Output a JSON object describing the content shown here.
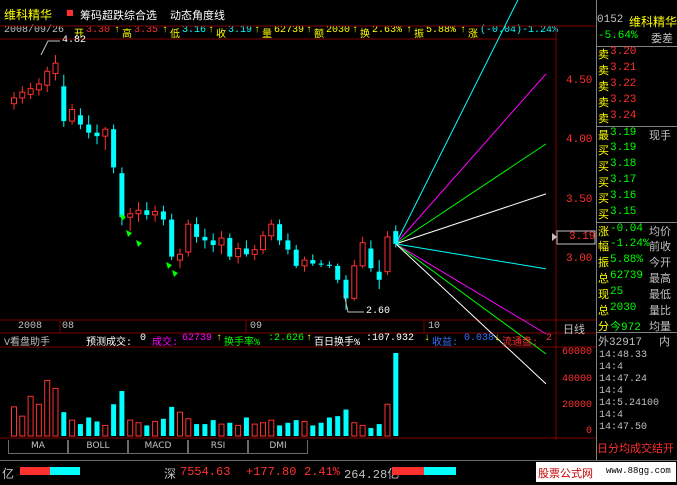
{
  "title": {
    "stock_name": "维科精华",
    "indicator_name": "筹码超跌综合选",
    "overlay_name": "动态角度线",
    "code_tail": "0152",
    "right_name": "维科精华"
  },
  "infobar": {
    "date": "2008/09/26",
    "open_label": "开",
    "open": "3.30",
    "high_label": "高",
    "high": "3.35",
    "low_label": "低",
    "low": "3.16",
    "close_label": "收",
    "close": "3.19",
    "volume_label": "量",
    "volume": "62739",
    "amount_label": "额",
    "amount": "2030",
    "turnover_label": "换",
    "turnover": "2.63%",
    "amplitude_label": "振",
    "amplitude": "5.88%",
    "change_label": "涨",
    "change": "(-0.04)-1.24%"
  },
  "price_axis": {
    "labels": [
      "4.50",
      "4.00",
      "3.50",
      "3.00"
    ],
    "current_tag": "3.19",
    "high_note": "4.82",
    "low_note": "2.60"
  },
  "time_axis": {
    "labels": [
      "2008",
      "08",
      "09",
      "10"
    ],
    "period": "日线"
  },
  "volume_panel": {
    "name": "V看盘助手",
    "forecast_label": "预测成交:",
    "forecast": "0",
    "vol_label": "成交:",
    "vol": "62739",
    "turn_label": "换手率%",
    "turn": ":2.626",
    "bh_label": "百日换手%",
    "bh": ":107.932",
    "close_label": "收益:",
    "close_val": "0.038",
    "lt_label": "流通盘:",
    "lt": "2",
    "axis": [
      "60000",
      "40000",
      "20000",
      "0"
    ]
  },
  "tabs": [
    "MA",
    "BOLL",
    "MACD",
    "RSI",
    "DMI"
  ],
  "right_panel": {
    "top_change": "-5.64%",
    "top_label": "委差",
    "asks": [
      {
        "label": "卖",
        "price": "3.24"
      },
      {
        "label": "卖",
        "price": "3.23"
      },
      {
        "label": "卖",
        "price": "3.22"
      },
      {
        "label": "卖",
        "price": "3.21"
      },
      {
        "label": "卖",
        "price": "3.20"
      }
    ],
    "best_label": "最",
    "best_price": "3.19",
    "best_tail": "现手",
    "bids": [
      {
        "label": "买",
        "price": "3.19"
      },
      {
        "label": "买",
        "price": "3.18"
      },
      {
        "label": "买",
        "price": "3.17"
      },
      {
        "label": "买",
        "price": "3.16"
      },
      {
        "label": "买",
        "price": "3.15"
      }
    ],
    "stats": [
      {
        "l": "涨",
        "v": "-0.04",
        "t": "均价"
      },
      {
        "l": "幅",
        "v": "-1.24%",
        "t": "前收"
      },
      {
        "l": "振",
        "v": "5.88%",
        "t": "今开"
      },
      {
        "l": "总",
        "v": "62739",
        "t": "最高"
      },
      {
        "l": "现",
        "v": "25",
        "t": "最低"
      },
      {
        "l": "总",
        "v": "2030",
        "t": "量比"
      },
      {
        "l": "分",
        "v": "今972",
        "t": "均量"
      }
    ],
    "ticks_header": "外32917",
    "ticks_header2": "内",
    "ticks": [
      "14:48.33",
      "14:4",
      "14:47.24",
      "14:4",
      "14:5.24100",
      "14:4",
      "14:47.50"
    ],
    "bottom_text": "日分均成交结开"
  },
  "statusbar": {
    "left_unit": "亿",
    "index_name": "深",
    "index_value": "7554.63",
    "index_change": "+177.80",
    "index_pct": "2.41%",
    "index_amount": "264.28亿",
    "ad_text": "股票公式网",
    "ad_url": "www.88gg.com"
  },
  "colors": {
    "up": "#ff3030",
    "down": "#00ffff",
    "white": "#ffffff",
    "yellow": "#ffff00",
    "magenta": "#ff00ff",
    "green": "#00ff00",
    "grid": "#800000"
  },
  "chart_data": {
    "type": "candlestick",
    "ylim": [
      2.55,
      4.95
    ],
    "candles": [
      {
        "o": 4.4,
        "h": 4.5,
        "l": 4.35,
        "c": 4.45
      },
      {
        "o": 4.45,
        "h": 4.55,
        "l": 4.4,
        "c": 4.5
      },
      {
        "o": 4.48,
        "h": 4.58,
        "l": 4.44,
        "c": 4.53
      },
      {
        "o": 4.52,
        "h": 4.62,
        "l": 4.47,
        "c": 4.57
      },
      {
        "o": 4.56,
        "h": 4.72,
        "l": 4.5,
        "c": 4.68
      },
      {
        "o": 4.66,
        "h": 4.82,
        "l": 4.6,
        "c": 4.75
      },
      {
        "o": 4.55,
        "h": 4.65,
        "l": 4.2,
        "c": 4.25
      },
      {
        "o": 4.25,
        "h": 4.4,
        "l": 4.22,
        "c": 4.35
      },
      {
        "o": 4.3,
        "h": 4.36,
        "l": 4.18,
        "c": 4.22
      },
      {
        "o": 4.22,
        "h": 4.3,
        "l": 4.1,
        "c": 4.15
      },
      {
        "o": 4.15,
        "h": 4.22,
        "l": 4.05,
        "c": 4.12
      },
      {
        "o": 4.12,
        "h": 4.2,
        "l": 4.0,
        "c": 4.18
      },
      {
        "o": 4.18,
        "h": 4.22,
        "l": 3.8,
        "c": 3.85
      },
      {
        "o": 3.8,
        "h": 3.85,
        "l": 3.35,
        "c": 3.42
      },
      {
        "o": 3.42,
        "h": 3.5,
        "l": 3.3,
        "c": 3.45
      },
      {
        "o": 3.45,
        "h": 3.55,
        "l": 3.38,
        "c": 3.48
      },
      {
        "o": 3.48,
        "h": 3.55,
        "l": 3.4,
        "c": 3.44
      },
      {
        "o": 3.44,
        "h": 3.52,
        "l": 3.38,
        "c": 3.47
      },
      {
        "o": 3.47,
        "h": 3.52,
        "l": 3.35,
        "c": 3.4
      },
      {
        "o": 3.4,
        "h": 3.45,
        "l": 3.05,
        "c": 3.08
      },
      {
        "o": 3.05,
        "h": 3.15,
        "l": 2.98,
        "c": 3.1
      },
      {
        "o": 3.12,
        "h": 3.4,
        "l": 3.08,
        "c": 3.36
      },
      {
        "o": 3.36,
        "h": 3.42,
        "l": 3.2,
        "c": 3.25
      },
      {
        "o": 3.25,
        "h": 3.32,
        "l": 3.15,
        "c": 3.22
      },
      {
        "o": 3.22,
        "h": 3.28,
        "l": 3.12,
        "c": 3.18
      },
      {
        "o": 3.18,
        "h": 3.3,
        "l": 3.1,
        "c": 3.24
      },
      {
        "o": 3.24,
        "h": 3.28,
        "l": 3.05,
        "c": 3.08
      },
      {
        "o": 3.08,
        "h": 3.2,
        "l": 3.02,
        "c": 3.15
      },
      {
        "o": 3.15,
        "h": 3.22,
        "l": 3.08,
        "c": 3.1
      },
      {
        "o": 3.1,
        "h": 3.18,
        "l": 3.05,
        "c": 3.14
      },
      {
        "o": 3.14,
        "h": 3.3,
        "l": 3.1,
        "c": 3.26
      },
      {
        "o": 3.26,
        "h": 3.4,
        "l": 3.22,
        "c": 3.36
      },
      {
        "o": 3.36,
        "h": 3.4,
        "l": 3.18,
        "c": 3.22
      },
      {
        "o": 3.22,
        "h": 3.28,
        "l": 3.1,
        "c": 3.14
      },
      {
        "o": 3.14,
        "h": 3.18,
        "l": 2.98,
        "c": 3.0
      },
      {
        "o": 3.0,
        "h": 3.08,
        "l": 2.95,
        "c": 3.05
      },
      {
        "o": 3.05,
        "h": 3.1,
        "l": 3.0,
        "c": 3.02
      },
      {
        "o": 3.02,
        "h": 3.05,
        "l": 2.99,
        "c": 3.01
      },
      {
        "o": 3.01,
        "h": 3.04,
        "l": 2.98,
        "c": 3.0
      },
      {
        "o": 3.0,
        "h": 3.02,
        "l": 2.85,
        "c": 2.88
      },
      {
        "o": 2.88,
        "h": 2.92,
        "l": 2.62,
        "c": 2.72
      },
      {
        "o": 2.72,
        "h": 3.05,
        "l": 2.7,
        "c": 3.0
      },
      {
        "o": 3.0,
        "h": 3.25,
        "l": 2.98,
        "c": 3.2
      },
      {
        "o": 3.15,
        "h": 3.22,
        "l": 2.95,
        "c": 2.98
      },
      {
        "o": 2.95,
        "h": 3.05,
        "l": 2.8,
        "c": 2.88
      },
      {
        "o": 2.95,
        "h": 3.3,
        "l": 2.92,
        "c": 3.25
      },
      {
        "o": 3.3,
        "h": 3.35,
        "l": 3.16,
        "c": 3.19
      }
    ],
    "volume": [
      22000,
      15000,
      30000,
      24000,
      42000,
      36000,
      18000,
      12000,
      9000,
      14000,
      11000,
      8000,
      24000,
      34000,
      12000,
      10000,
      8000,
      11000,
      13000,
      22000,
      18000,
      13000,
      9000,
      9000,
      12000,
      9000,
      10000,
      8000,
      14000,
      9000,
      10000,
      12000,
      8000,
      10000,
      12000,
      11000,
      8000,
      10000,
      14000,
      15000,
      20000,
      10000,
      8000,
      6000,
      9000,
      24000,
      62739
    ],
    "vol_ylim": [
      0,
      65000
    ]
  }
}
